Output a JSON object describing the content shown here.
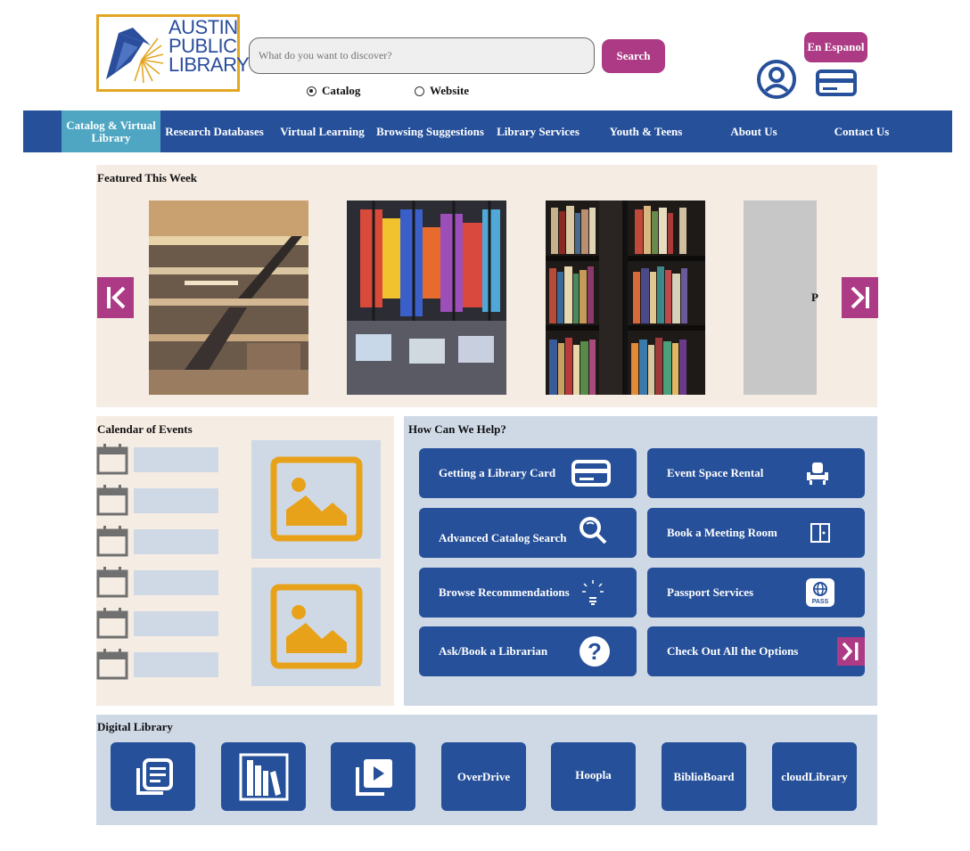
{
  "logo": {
    "line1": "AUSTIN",
    "line2": "PUBLIC",
    "line3": "LIBRARY"
  },
  "search": {
    "placeholder": "What do you want to discover?",
    "button_label": "Search"
  },
  "scope": {
    "options": [
      "Catalog",
      "Website"
    ],
    "selected": "Catalog"
  },
  "header": {
    "espanol_label": "En Espanol",
    "account_icon": "user-circle-icon",
    "card_icon": "library-card-icon"
  },
  "nav": {
    "items": [
      {
        "label": "Catalog & Virtual Library",
        "active": true
      },
      {
        "label": "Research Databases"
      },
      {
        "label": "Virtual Learning"
      },
      {
        "label": "Browsing Suggestions"
      },
      {
        "label": "Library Services"
      },
      {
        "label": "Youth & Teens"
      },
      {
        "label": "About Us"
      },
      {
        "label": "Contact Us"
      }
    ]
  },
  "featured": {
    "title": "Featured This Week",
    "partial_letter": "P",
    "prev_icon": "chevron-left-bar-icon",
    "next_icon": "chevron-right-bar-icon"
  },
  "calendar": {
    "title": "Calendar of Events",
    "row_count": 6
  },
  "help": {
    "title": "How Can We Help?",
    "buttons": [
      {
        "label": "Getting a Library Card",
        "icon": "library-card-icon"
      },
      {
        "label": "Event Space Rental",
        "icon": "chair-icon"
      },
      {
        "label": "Advanced Catalog Search",
        "icon": "magnify-icon"
      },
      {
        "label": "Book a Meeting Room",
        "icon": "door-icon"
      },
      {
        "label": "Browse Recommendations",
        "icon": "lightbulb-icon"
      },
      {
        "label": "Passport Services",
        "icon": "passport-icon",
        "icon_text": "PASS"
      },
      {
        "label": "Ask/Book a Librarian",
        "icon": "question-icon",
        "icon_text": "?"
      },
      {
        "label": "Check Out All the Options",
        "icon": "chevron-right-bar-icon"
      }
    ]
  },
  "digital": {
    "title": "Digital Library",
    "tiles": [
      {
        "label": "",
        "icon": "ebook-stack-icon"
      },
      {
        "label": "",
        "icon": "bookshelf-icon"
      },
      {
        "label": "",
        "icon": "video-library-icon"
      },
      {
        "label": "OverDrive"
      },
      {
        "label": "Hoopla"
      },
      {
        "label": "BiblioBoard"
      },
      {
        "label": "cloudLibrary"
      }
    ]
  },
  "colors": {
    "nav_blue": "#26509a",
    "nav_active": "#4ea6c2",
    "accent_magenta": "#ad3a84",
    "panel_beige": "#f5ece3",
    "panel_blue": "#cfd9e6",
    "logo_gold": "#e3a623",
    "placeholder_orange": "#e8a21a"
  }
}
